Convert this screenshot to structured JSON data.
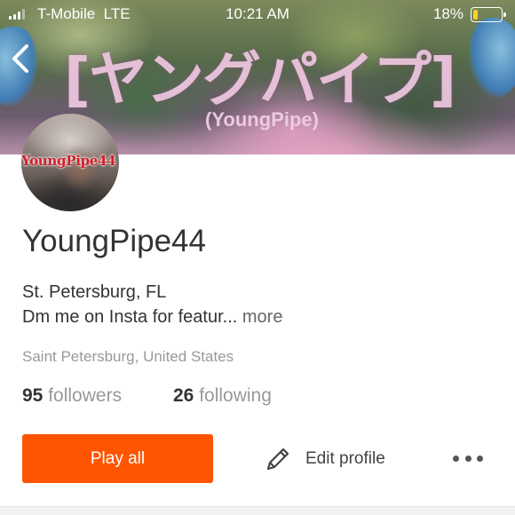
{
  "status_bar": {
    "carrier": "T-Mobile",
    "network": "LTE",
    "time": "10:21 AM",
    "battery_percent": "18%",
    "battery_level": 0.18,
    "battery_color": "#f5d226"
  },
  "header": {
    "back_icon": "chevron-left-icon",
    "banner_title": "[ヤングパイプ]",
    "banner_subtitle": "(YoungPipe)"
  },
  "profile": {
    "avatar_text": "YoungPipe44",
    "username": "YoungPipe44",
    "bio_line1": "St. Petersburg, FL",
    "bio_line2": "Dm me on Insta for featur...",
    "more_label": "more",
    "location": "Saint Petersburg, United States",
    "followers_count": "95",
    "followers_label": "followers",
    "following_count": "26",
    "following_label": "following"
  },
  "actions": {
    "play_all_label": "Play all",
    "play_all_color": "#ff5500",
    "edit_profile_label": "Edit profile",
    "edit_icon": "pencil-icon",
    "more_icon": "more-horizontal-icon"
  }
}
